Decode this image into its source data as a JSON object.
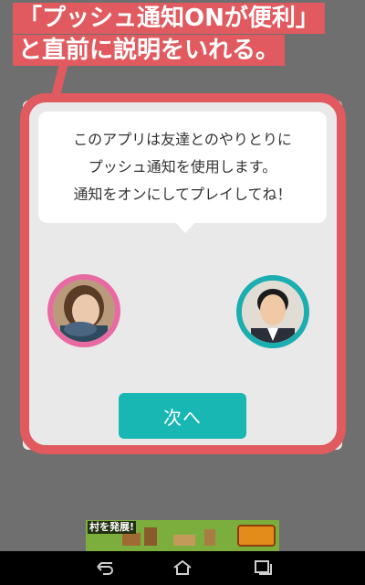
{
  "annotation": {
    "line1": "「プッシュ通知ONが便利」",
    "line2": "と直前に説明をいれる。"
  },
  "dialog": {
    "message": "このアプリは友達とのやりとりに\nプッシュ通知を使用します。\n通知をオンにしてプレイしてね！",
    "next_label": "次へ"
  },
  "ad": {
    "title": "村を発展!"
  },
  "colors": {
    "annotation": "#e05a5f",
    "accent": "#18b7b4",
    "avatar_left_ring": "#e96aa2",
    "avatar_right_ring": "#1aaeb0"
  },
  "navbar": {
    "icons": [
      "back-icon",
      "home-icon",
      "recent-apps-icon"
    ]
  }
}
